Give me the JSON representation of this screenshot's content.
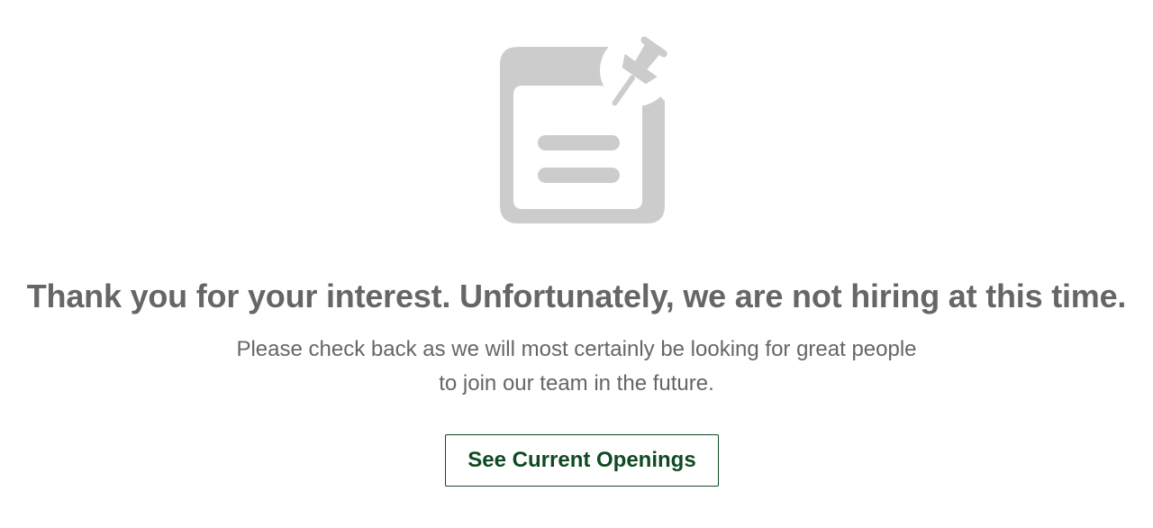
{
  "icons": {
    "main": "pinned-note-icon"
  },
  "colors": {
    "icon": "#cccccc",
    "text": "#666666",
    "button": "#0f4a22",
    "background": "#ffffff"
  },
  "message": {
    "headline": "Thank you for your interest. Unfortunately, we are not hiring at this time.",
    "subtext_line1": "Please check back as we will most certainly be looking for great people",
    "subtext_line2": "to join our team in the future."
  },
  "actions": {
    "see_openings_label": "See Current Openings"
  }
}
